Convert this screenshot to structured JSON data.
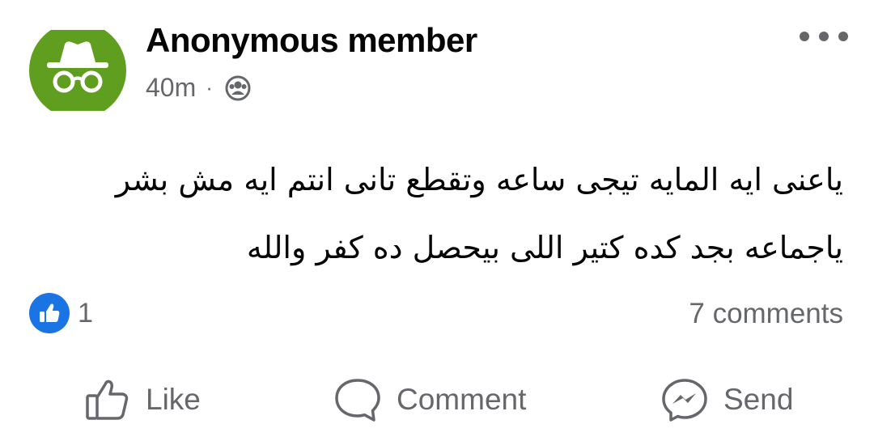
{
  "post": {
    "author": "Anonymous member",
    "time": "40m",
    "separator": "·",
    "audience_icon": "group-icon",
    "text_lines": [
      "ياعنى ايه المايه تيجى ساعه وتقطع تانى انتم ايه مش بشر",
      "ياجماعه بجد كده كتير اللى بيحصل ده كفر والله"
    ]
  },
  "reactions": {
    "icon": "thumbs-up-icon",
    "count": "1",
    "comments": "7 comments"
  },
  "actions": {
    "like": "Like",
    "comment": "Comment",
    "send": "Send"
  },
  "colors": {
    "avatar_bg": "#5f9e1f",
    "like_blue": "#1b74e4",
    "secondary_text": "#65676b"
  }
}
